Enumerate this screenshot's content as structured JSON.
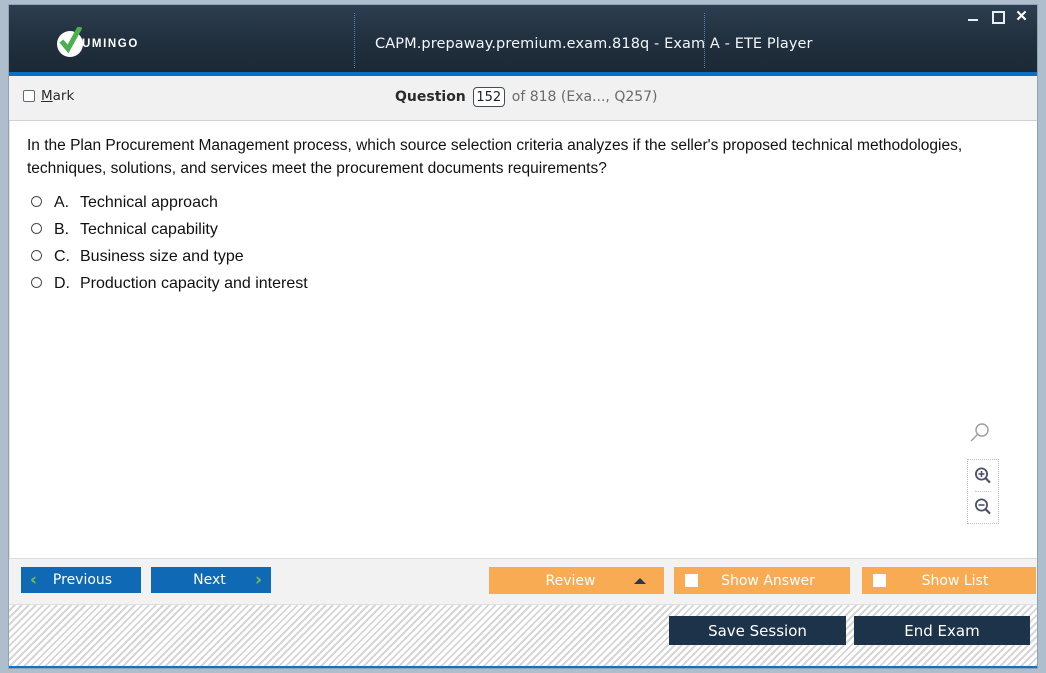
{
  "window": {
    "title": "CAPM.prepaway.premium.exam.818q - Exam A - ETE Player",
    "brand": "UMINGO",
    "controls": {
      "minimize": "minimize",
      "maximize": "maximize",
      "close": "✕"
    }
  },
  "toolbar": {
    "mark_label_accel": "M",
    "mark_label_rest": "ark",
    "question_word": "Question",
    "question_number": "152",
    "question_of": "of 818 (Exa..., Q257)"
  },
  "question": {
    "text": "In the Plan Procurement Management process, which source selection criteria analyzes if the seller's proposed technical methodologies, techniques, solutions, and services meet the procurement documents requirements?",
    "options": [
      {
        "letter": "A.",
        "text": "Technical approach"
      },
      {
        "letter": "B.",
        "text": "Technical capability"
      },
      {
        "letter": "C.",
        "text": "Business size and type"
      },
      {
        "letter": "D.",
        "text": "Production capacity and interest"
      }
    ]
  },
  "zoom_tools": {
    "cursor_icon": "magnifier-icon",
    "zoom_in_icon": "zoom-in-icon",
    "zoom_out_icon": "zoom-out-icon"
  },
  "buttons": {
    "previous": "Previous",
    "next": "Next",
    "review": "Review",
    "show_answer": "Show Answer",
    "show_list": "Show List",
    "save_session": "Save Session",
    "end_exam": "End Exam",
    "prev_chevron": "‹",
    "next_chevron": "›"
  },
  "colors": {
    "titlebar": "#22313f",
    "accent_blue": "#0b6fc4",
    "button_blue": "#0f69b4",
    "chevron_green": "#7ac143",
    "button_orange": "#f8ab52",
    "button_navy": "#1d3349",
    "logo_green": "#4caf50"
  }
}
